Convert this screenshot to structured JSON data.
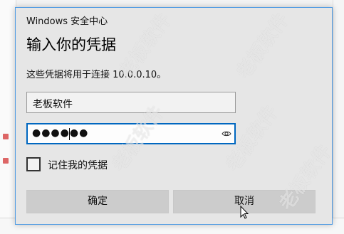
{
  "dialog": {
    "app_title": "Windows 安全中心",
    "heading": "输入你的凭据",
    "description": "这些凭据将用于连接 10.0.0.10。",
    "username": {
      "value": "老板软件"
    },
    "password": {
      "masked_value": "●●●●●●"
    },
    "remember_label": "记住我的凭据",
    "remember_checked": false,
    "ok_label": "确定",
    "cancel_label": "取消"
  },
  "watermark_text": "老板软件",
  "colors": {
    "focus_border": "#0067c0",
    "dialog_border": "#4f9be3",
    "dialog_bg": "#e6e6e6",
    "button_bg": "#cccccc"
  },
  "icons": [
    "eye-icon",
    "checkbox",
    "mouse-pointer-icon"
  ]
}
